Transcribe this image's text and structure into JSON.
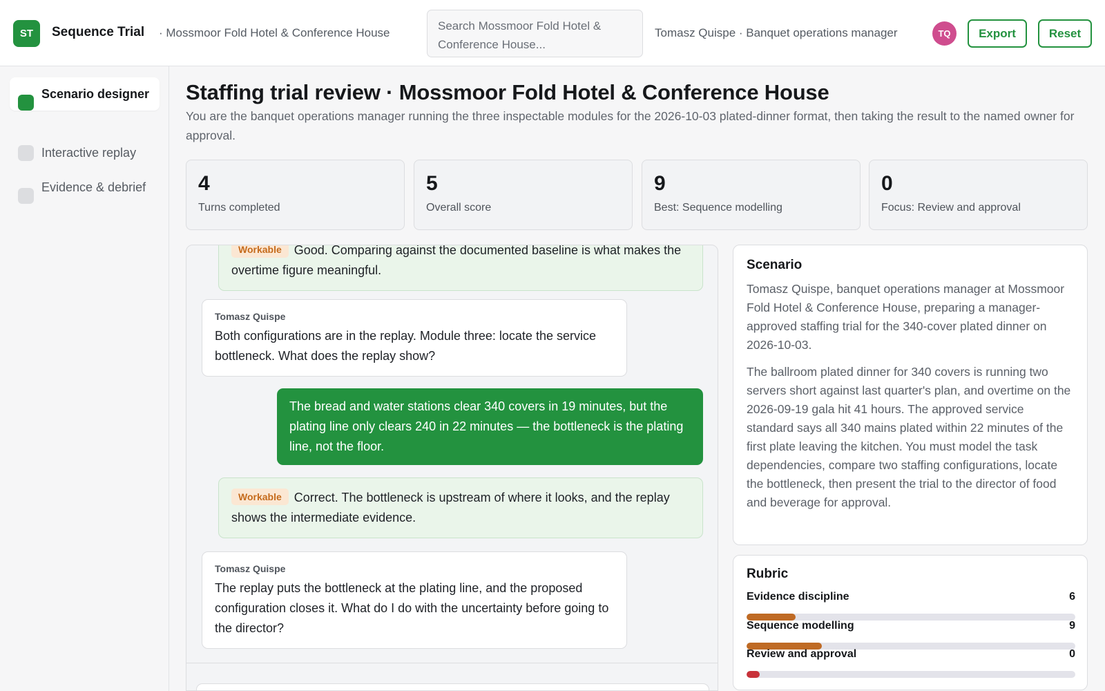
{
  "header": {
    "logo_initials": "ST",
    "app_title": "Sequence Trial",
    "venue_crumb": "· Mossmoor Fold Hotel & Conference House",
    "search_placeholder": "Search Mossmoor Fold Hotel & Conference House...",
    "user_line": "Tomasz Quispe · Banquet operations manager",
    "avatar_initials": "TQ",
    "export_label": "Export",
    "reset_label": "Reset"
  },
  "sidebar": {
    "items": [
      {
        "label": "Scenario designer",
        "active": true
      },
      {
        "label": "Interactive replay",
        "active": false
      },
      {
        "label": "Evidence & debrief",
        "active": false
      }
    ]
  },
  "main": {
    "title": "Staffing trial review · Mossmoor Fold Hotel & Conference House",
    "subtitle": "You are the banquet operations manager running the three inspectable modules for the 2026-10-03 plated-dinner format, then taking the result to the named owner for approval."
  },
  "stats": [
    {
      "value": "4",
      "label": "Turns completed"
    },
    {
      "value": "5",
      "label": "Overall score"
    },
    {
      "value": "9",
      "label": "Best: Sequence modelling"
    },
    {
      "value": "0",
      "label": "Focus: Review and approval"
    }
  ],
  "chat": {
    "messages": [
      {
        "kind": "feedback",
        "tag": "Workable",
        "text": "Good. Comparing against the documented baseline is what makes the overtime figure meaningful."
      },
      {
        "kind": "coach",
        "author": "Tomasz Quispe",
        "text": "Both configurations are in the replay. Module three: locate the service bottleneck. What does the replay show?"
      },
      {
        "kind": "user",
        "text": "The bread and water stations clear 340 covers in 19 minutes, but the plating line only clears 240 in 22 minutes — the bottleneck is the plating line, not the floor."
      },
      {
        "kind": "feedback",
        "tag": "Workable",
        "text": "Correct. The bottleneck is upstream of where it looks, and the replay shows the intermediate evidence."
      },
      {
        "kind": "coach",
        "author": "Tomasz Quispe",
        "text": "The replay puts the bottleneck at the plating line, and the proposed configuration closes it. What do I do with the uncertainty before going to the director?"
      }
    ]
  },
  "scenario": {
    "title": "Scenario",
    "para1": "Tomasz Quispe, banquet operations manager at Mossmoor Fold Hotel & Conference House, preparing a manager-approved staffing trial for the 340-cover plated dinner on 2026-10-03.",
    "para2": "The ballroom plated dinner for 340 covers is running two servers short against last quarter's plan, and overtime on the 2026-09-19 gala hit 41 hours. The approved service standard says all 340 mains plated within 22 minutes of the first plate leaving the kitchen. You must model the task dependencies, compare two staffing configurations, locate the bottleneck, then present the trial to the director of food and beverage for approval."
  },
  "rubric": {
    "title": "Rubric",
    "rows": [
      {
        "name": "Evidence discipline",
        "score": "6",
        "fraction": 0.15,
        "color": "#bf6a24"
      },
      {
        "name": "Sequence modelling",
        "score": "9",
        "fraction": 0.23,
        "color": "#bf6a24"
      },
      {
        "name": "Review and approval",
        "score": "0",
        "fraction": 0.04,
        "color": "#c8323a"
      }
    ]
  }
}
